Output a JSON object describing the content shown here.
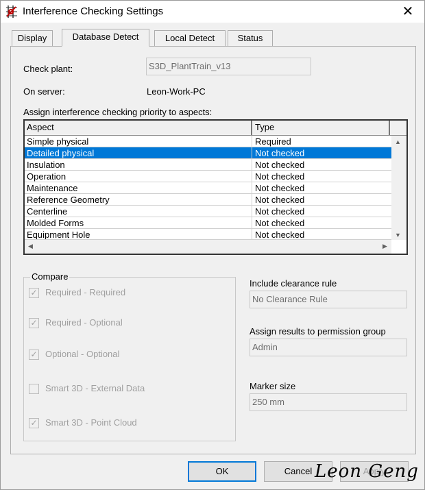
{
  "window": {
    "title": "Interference Checking Settings",
    "close_symbol": "✕",
    "icon": "interference-app-icon"
  },
  "tabs": [
    {
      "label": "Display",
      "active": false
    },
    {
      "label": "Database Detect",
      "active": true
    },
    {
      "label": "Local Detect",
      "active": false
    },
    {
      "label": "Status",
      "active": false
    }
  ],
  "fields": {
    "check_plant_label": "Check plant:",
    "check_plant_value": "S3D_PlantTrain_v13",
    "on_server_label": "On server:",
    "on_server_value": "Leon-Work-PC",
    "assign_priority_label": "Assign interference checking priority to aspects:"
  },
  "grid": {
    "columns": [
      "Aspect",
      "Type"
    ],
    "rows": [
      {
        "aspect": "Simple physical",
        "type": "Required",
        "selected": false
      },
      {
        "aspect": "Detailed physical",
        "type": "Not checked",
        "selected": true
      },
      {
        "aspect": "Insulation",
        "type": "Not checked",
        "selected": false
      },
      {
        "aspect": "Operation",
        "type": "Not checked",
        "selected": false
      },
      {
        "aspect": "Maintenance",
        "type": "Not checked",
        "selected": false
      },
      {
        "aspect": "Reference Geometry",
        "type": "Not checked",
        "selected": false
      },
      {
        "aspect": "Centerline",
        "type": "Not checked",
        "selected": false
      },
      {
        "aspect": "Molded Forms",
        "type": "Not checked",
        "selected": false
      },
      {
        "aspect": "Equipment Hole",
        "type": "Not checked",
        "selected": false
      }
    ]
  },
  "compare": {
    "title": "Compare",
    "options": [
      {
        "label": "Required - Required",
        "checked": true,
        "enabled": false
      },
      {
        "label": "Required - Optional",
        "checked": true,
        "enabled": false
      },
      {
        "label": "Optional - Optional",
        "checked": true,
        "enabled": false
      },
      {
        "label": "Smart 3D - External Data",
        "checked": false,
        "enabled": false
      },
      {
        "label": "Smart 3D - Point Cloud",
        "checked": true,
        "enabled": false
      }
    ]
  },
  "right_panel": {
    "clearance_label": "Include clearance rule",
    "clearance_value": "No Clearance Rule",
    "permission_label": "Assign results to permission group",
    "permission_value": "Admin",
    "marker_label": "Marker size",
    "marker_value": "250 mm"
  },
  "buttons": {
    "ok": "OK",
    "cancel": "Cancel",
    "apply": "Apply"
  },
  "watermark": "Leon Geng",
  "colors": {
    "selection": "#0078d7",
    "dialog_bg": "#f0f0f0",
    "disabled_text": "#a0a0a0"
  }
}
